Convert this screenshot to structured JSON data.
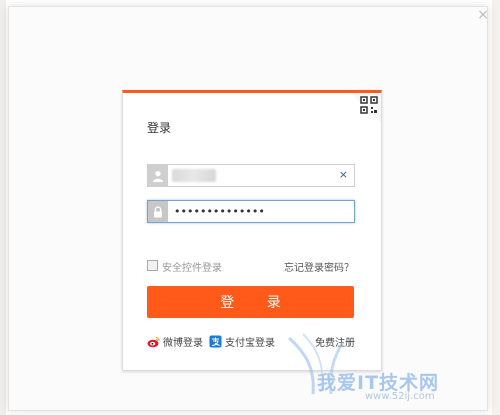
{
  "dialog": {
    "title": "登录",
    "username": {
      "value": "",
      "clear_symbol": "×"
    },
    "password": {
      "value": "••••••••••••••"
    },
    "safe_control_label": "安全控件登录",
    "forgot_password": "忘记登录密码？",
    "login_button": "登 录",
    "weibo_label": "微博登录",
    "alipay_label": "支付宝登录",
    "register_label": "免费注册"
  },
  "window": {
    "close_symbol": "×"
  },
  "watermark": {
    "text": "我爱IT技术网",
    "sub": "www.52ij.com"
  },
  "colors": {
    "accent": "#ff5a1a",
    "focus_border": "#6fa6d6"
  },
  "icons": [
    "close-icon",
    "qr-code-icon",
    "user-icon",
    "lock-icon",
    "clear-icon",
    "weibo-icon",
    "alipay-icon"
  ]
}
